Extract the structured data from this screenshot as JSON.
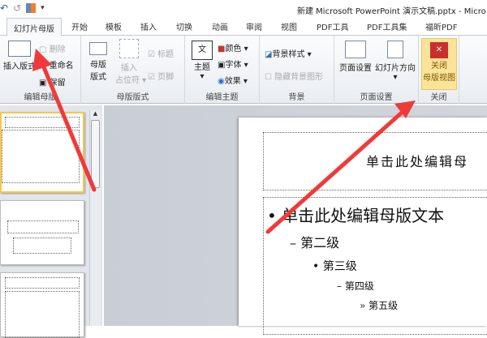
{
  "window": {
    "title": "新建 Microsoft PowerPoint 演示文稿.pptx  -  Micro"
  },
  "qat": {
    "undo": "↶",
    "redo": "↺",
    "more": "▾"
  },
  "tabs": [
    "幻灯片母版",
    "开始",
    "模板",
    "插入",
    "切换",
    "动画",
    "审阅",
    "视图",
    "PDF工具",
    "PDF工具集",
    "福昕PDF"
  ],
  "ribbon": {
    "edit_master": {
      "label": "编辑母版",
      "insert_layout": "插入版式",
      "delete": "删除",
      "rename": "重命名",
      "preserve": "保留"
    },
    "master_layout": {
      "label": "母版版式",
      "master_layout": "母版\n版式",
      "master_layout_l1": "母版",
      "master_layout_l2": "版式",
      "insert_ph_l1": "插入",
      "insert_ph_l2": "占位符",
      "title_cb": "标题",
      "footer_cb": "页脚"
    },
    "edit_theme": {
      "label": "编辑主题",
      "theme": "主题",
      "colors": "颜色",
      "fonts": "字体",
      "effects": "效果"
    },
    "background": {
      "label": "背景",
      "bg_styles": "背景样式",
      "hide_bg": "隐藏背景图形"
    },
    "page_setup": {
      "label": "页面设置",
      "page_setup": "页面设置",
      "orientation": "幻灯片方向"
    },
    "close": {
      "label": "关闭",
      "close_l1": "关闭",
      "close_l2": "母版视图"
    }
  },
  "slide": {
    "title": "单击此处编辑母",
    "levels": [
      "单击此处编辑母版文本",
      "第二级",
      "第三级",
      "第四级",
      "第五级"
    ],
    "bullets": [
      "•",
      "–",
      "•",
      "–",
      "»"
    ]
  },
  "colors": {
    "arrow": "#f03a3a",
    "close_bg": "#fbe39a",
    "selected_thumb": "#f3c94a"
  }
}
